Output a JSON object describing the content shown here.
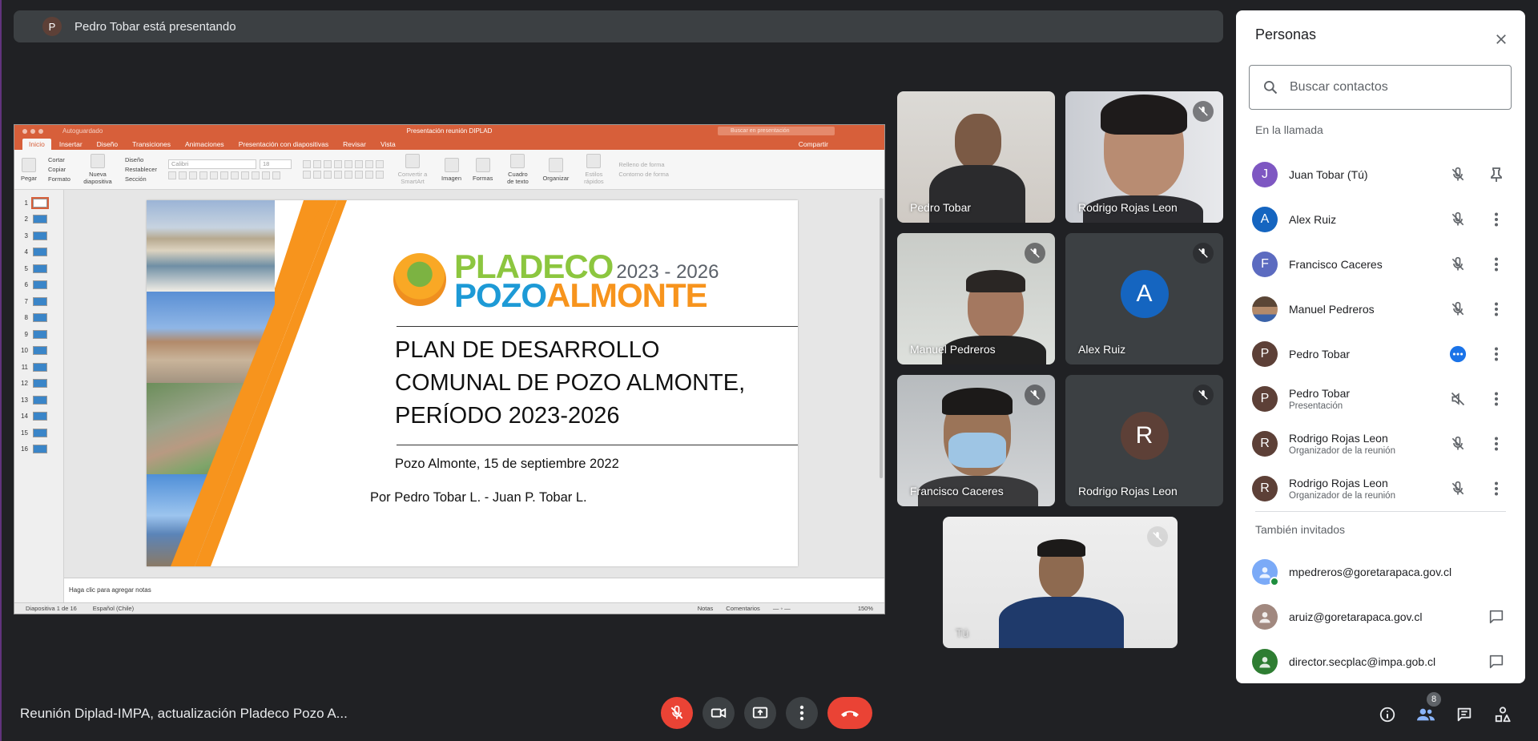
{
  "banner": {
    "avatar_letter": "P",
    "text": "Pedro Tobar está presentando"
  },
  "ppt": {
    "doc_title": "Presentación reunión DIPLAD",
    "autosave": "Autoguardado",
    "search_placeholder": "Buscar en presentación",
    "tabs": [
      "Inicio",
      "Insertar",
      "Diseño",
      "Transiciones",
      "Animaciones",
      "Presentación con diapositivas",
      "Revisar",
      "Vista"
    ],
    "share": "Compartir",
    "ribbon": {
      "paste": "Pegar",
      "cut": "Cortar",
      "copy": "Copiar",
      "format": "Formato",
      "new_slide": "Nueva diapositiva",
      "layout": "Diseño",
      "reset": "Restablecer",
      "section": "Sección",
      "font": "Calibri",
      "font_size": "18",
      "convert": "Convertir a SmartArt",
      "image": "Imagen",
      "shapes": "Formas",
      "textbox": "Cuadro de texto",
      "arrange": "Organizar",
      "quick_styles": "Estilos rápidos",
      "fill": "Relleno de forma",
      "outline": "Contorno de forma"
    },
    "slide_numbers": [
      "1",
      "2",
      "3",
      "4",
      "5",
      "6",
      "7",
      "8",
      "9",
      "10",
      "11",
      "12",
      "13",
      "14",
      "15",
      "16"
    ],
    "slide": {
      "logo_line1": "PLADECO",
      "logo_years": "2023 - 2026",
      "logo_line2a": "POZO",
      "logo_line2b": "ALMONTE",
      "heading1": "PLAN DE DESARROLLO",
      "heading2": "COMUNAL DE POZO ALMONTE,",
      "heading3": "PERÍODO 2023-2026",
      "date": "Pozo Almonte, 15 de septiembre 2022",
      "authors": "Por Pedro Tobar L. -  Juan P. Tobar L."
    },
    "notes_placeholder": "Haga clic para agregar notas",
    "status": {
      "slide_of": "Diapositiva 1 de 16",
      "language": "Español (Chile)",
      "notes": "Notas",
      "comments": "Comentarios",
      "zoom": "150%"
    }
  },
  "tiles": [
    {
      "name": "Pedro Tobar"
    },
    {
      "name": "Rodrigo Rojas Leon"
    },
    {
      "name": "Manuel Pedreros"
    },
    {
      "name": "Alex Ruiz",
      "avatar": "A",
      "color": "#1565c0"
    },
    {
      "name": "Francisco Caceres"
    },
    {
      "name": "Rodrigo Rojas Leon",
      "avatar": "R",
      "color": "#5d4037"
    },
    {
      "name": "Tú"
    }
  ],
  "panel": {
    "title": "Personas",
    "search_placeholder": "Buscar contactos",
    "in_call_label": "En la llamada",
    "in_call": [
      {
        "letter": "J",
        "name": "Juan Tobar (Tú)",
        "sub": "",
        "color": "#7e57c2"
      },
      {
        "letter": "A",
        "name": "Alex Ruiz",
        "sub": "",
        "color": "#1565c0"
      },
      {
        "letter": "F",
        "name": "Francisco Caceres",
        "sub": "",
        "color": "#5c6bc0"
      },
      {
        "letter": "",
        "name": "Manuel Pedreros",
        "sub": "",
        "color": "#8d6e63"
      },
      {
        "letter": "P",
        "name": "Pedro Tobar",
        "sub": "",
        "color": "#5d4037"
      },
      {
        "letter": "P",
        "name": "Pedro Tobar",
        "sub": "Presentación",
        "color": "#5d4037"
      },
      {
        "letter": "R",
        "name": "Rodrigo Rojas Leon",
        "sub": "Organizador de la reunión",
        "color": "#5d4037"
      },
      {
        "letter": "R",
        "name": "Rodrigo Rojas Leon",
        "sub": "Organizador de la reunión",
        "color": "#5d4037"
      }
    ],
    "invited_label": "También invitados",
    "invited": [
      {
        "email": "mpedreros@goretarapaca.gov.cl",
        "color": "#7baaf7"
      },
      {
        "email": "aruiz@goretarapaca.gov.cl",
        "color": "#a1887f"
      },
      {
        "email": "director.secplac@impa.gob.cl",
        "color": "#2e7d32"
      }
    ]
  },
  "bottom": {
    "meeting_title": "Reunión Diplad-IMPA, actualización Pladeco Pozo A...",
    "people_count": "8"
  },
  "colors": {
    "background": "#202124",
    "panel": "#ffffff",
    "danger": "#ea4335",
    "ppt_accent": "#d75f3a",
    "slide_orange": "#f7941d"
  }
}
